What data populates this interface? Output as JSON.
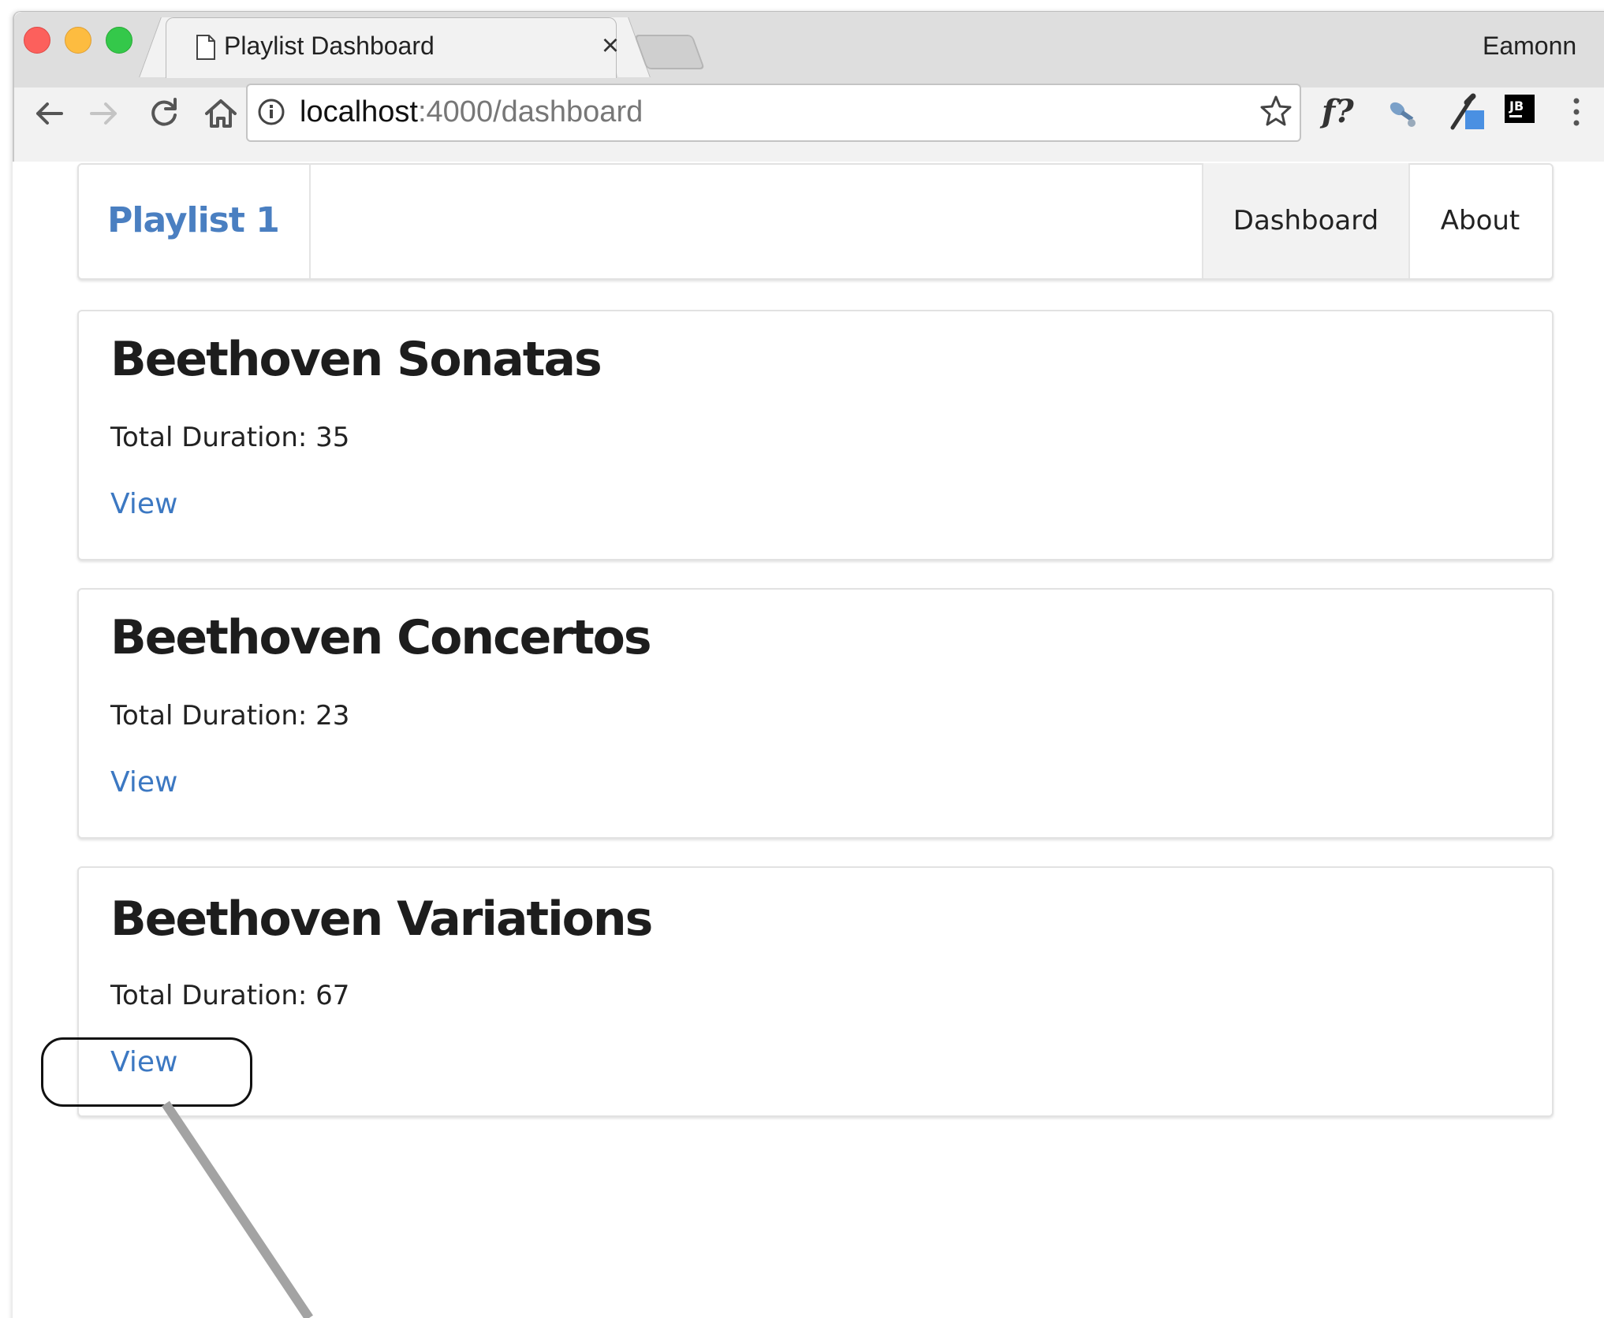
{
  "browser": {
    "tab_title": "Playlist Dashboard",
    "tab_close": "×",
    "profile_name": "Eamonn",
    "url_host": "localhost",
    "url_path": ":4000/dashboard",
    "extension_label": "f?"
  },
  "navbar": {
    "brand": "Playlist 1",
    "items": [
      {
        "label": "Dashboard",
        "active": true
      },
      {
        "label": "About",
        "active": false
      }
    ]
  },
  "playlists": [
    {
      "title": "Beethoven Sonatas",
      "duration_label": "Total Duration: 35",
      "view_label": "View"
    },
    {
      "title": "Beethoven Concertos",
      "duration_label": "Total Duration: 23",
      "view_label": "View"
    },
    {
      "title": "Beethoven Variations",
      "duration_label": "Total Duration: 67",
      "view_label": "View"
    }
  ],
  "colors": {
    "brand": "#4a7fc1",
    "link": "#3c78c2",
    "active_nav_bg": "#f2f2f2"
  },
  "icons": {
    "back": "arrow-left-icon",
    "forward": "arrow-right-icon",
    "reload": "reload-icon",
    "home": "home-icon",
    "info": "info-icon",
    "bookmark": "star-icon",
    "menu": "kebab-menu-icon"
  }
}
